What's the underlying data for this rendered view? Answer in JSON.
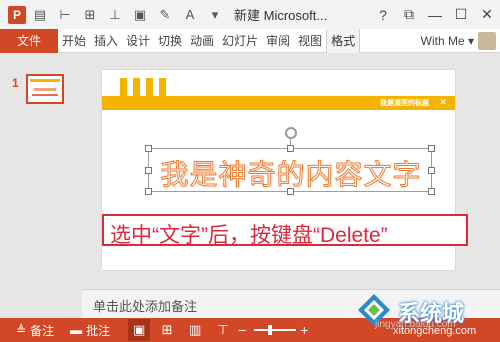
{
  "titlebar": {
    "app_logo": "P",
    "icons": [
      "save-icon",
      "undo-icon",
      "redo-icon",
      "present-icon",
      "align-icon",
      "layout-icon",
      "format-painter-icon",
      "font-color-icon",
      "more-icon"
    ],
    "font_letter": "A",
    "doc_title": "新建 Microsoft...",
    "help": "?",
    "restore": "⧉",
    "minimize": "—",
    "maximize": "☐",
    "close": "✕"
  },
  "ribbon": {
    "file": "文件",
    "tabs": [
      "开始",
      "插入",
      "设计",
      "切换",
      "动画",
      "幻灯片",
      "审阅",
      "视图",
      "格式"
    ],
    "user": "With Me"
  },
  "thumbs": {
    "number": "1"
  },
  "slide": {
    "bar_text": "我是漂亮的标题",
    "main_text": "我是神奇的内容文字",
    "instruction": "选中“文字”后，按键盘“Delete”"
  },
  "notes": {
    "placeholder": "单击此处添加备注"
  },
  "status": {
    "notes_label": "备注",
    "comments_label": "批注"
  },
  "watermark": {
    "brand": "系统城",
    "url": "xitongcheng.com",
    "baidu": "jingyan.baidu.com"
  },
  "colors": {
    "accent": "#d24726",
    "gold": "#f4b400",
    "text_orange": "#f07c34",
    "highlight_red": "#e0283c"
  }
}
